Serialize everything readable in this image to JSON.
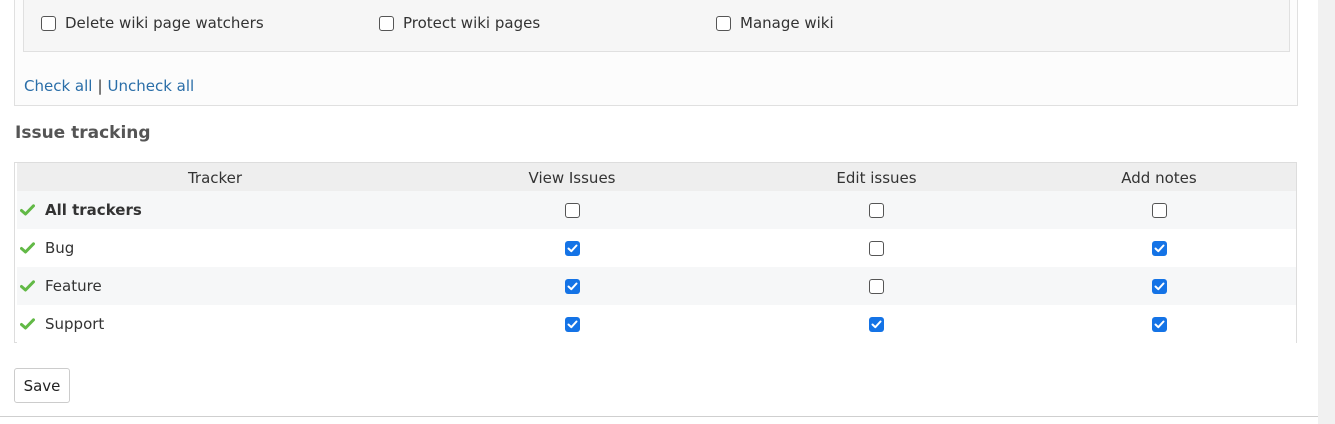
{
  "permissions": {
    "items": [
      {
        "label": "Delete wiki page watchers",
        "checked": false
      },
      {
        "label": "Protect wiki pages",
        "checked": false
      },
      {
        "label": "Manage wiki",
        "checked": false
      }
    ],
    "check_all": "Check all",
    "separator": "|",
    "uncheck_all": "Uncheck all"
  },
  "issue_tracking": {
    "title": "Issue tracking",
    "headers": [
      "Tracker",
      "View Issues",
      "Edit issues",
      "Add notes"
    ],
    "rows": [
      {
        "name": "All trackers",
        "bold": true,
        "view": false,
        "edit": false,
        "notes": false
      },
      {
        "name": "Bug",
        "bold": false,
        "view": true,
        "edit": false,
        "notes": true
      },
      {
        "name": "Feature",
        "bold": false,
        "view": true,
        "edit": false,
        "notes": true
      },
      {
        "name": "Support",
        "bold": false,
        "view": true,
        "edit": true,
        "notes": true
      }
    ]
  },
  "actions": {
    "save_label": "Save"
  },
  "colors": {
    "link": "#2a6ea8",
    "checkbox_checked": "#1473e6",
    "tick_icon": "#62b946"
  },
  "icons": {
    "tracker_enabled": "green-checkmark-icon"
  }
}
